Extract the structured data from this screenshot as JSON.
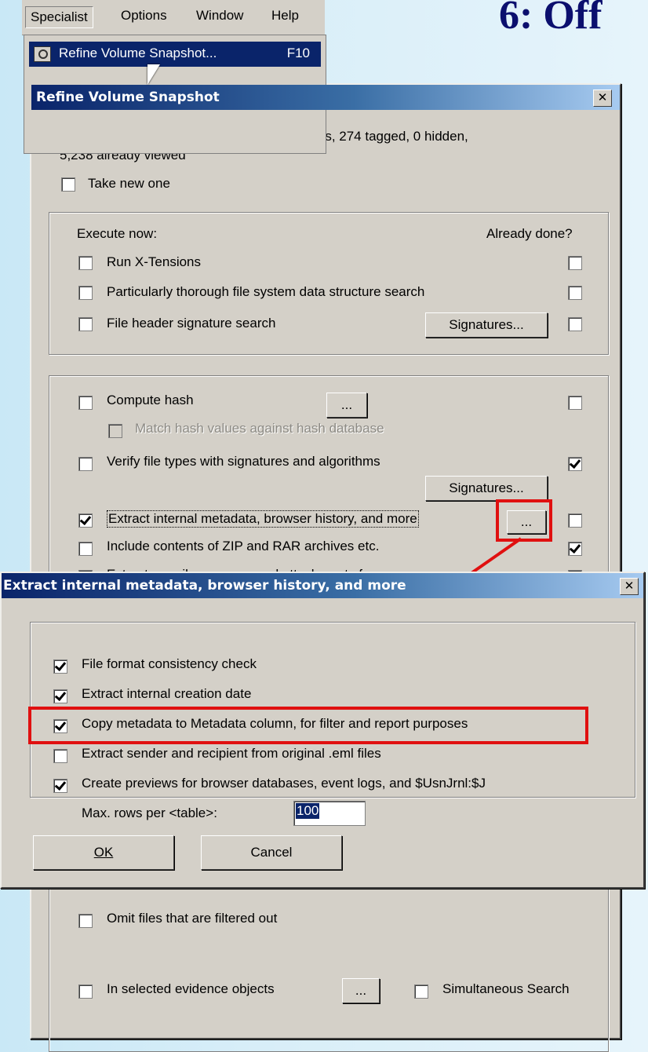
{
  "slide": {
    "title": "6: Off"
  },
  "menu": {
    "items": [
      "Specialist",
      "Options",
      "Window",
      "Help"
    ]
  },
  "dropdown": {
    "selected_label": "Refine Volume Snapshot...",
    "selected_key": "F10"
  },
  "refine": {
    "title": "Refine Volume Snapshot",
    "info_line1": "Volume snapshot of Ext2 Image: 13,493 items, 274 tagged, 0 hidden,",
    "info_line2": "5,238 already viewed",
    "take_new": "Take new one",
    "execute_now": "Execute now:",
    "already_done": "Already done?",
    "run_xtensions": "Run X-Tensions",
    "thorough_search": "Particularly thorough file system data structure search",
    "header_sig_search": "File header signature search",
    "signatures_btn": "Signatures...",
    "compute_hash": "Compute hash",
    "ellipsis": "...",
    "match_hash": "Match hash values against hash database",
    "verify_types": "Verify file types with signatures and algorithms",
    "signatures_btn2": "Signatures...",
    "extract_meta": "Extract internal metadata, browser history, and more",
    "include_zip": "Include contents of ZIP and RAR archives etc.",
    "extract_email": "Extract e-mail messages and attachments from",
    "omit_filtered": "Omit files that are filtered out",
    "in_selected": "In selected evidence objects",
    "simultaneous": "Simultaneous Search"
  },
  "meta_dialog": {
    "title": "Extract internal metadata, browser history, and more",
    "opt1": "File format consistency check",
    "opt2": "Extract internal creation date",
    "opt3": "Copy metadata to Metadata column, for filter and report purposes",
    "opt4": "Extract sender and recipient from original .eml files",
    "opt5": "Create previews for browser databases, event logs, and $UsnJrnl:$J",
    "max_rows_label": "Max. rows per <table>:",
    "max_rows_value": "100",
    "ok": "OK",
    "cancel": "Cancel"
  },
  "colors": {
    "highlight": "#e01010",
    "title_bar": "#0a246a",
    "slide_title": "#0b0f6e"
  }
}
